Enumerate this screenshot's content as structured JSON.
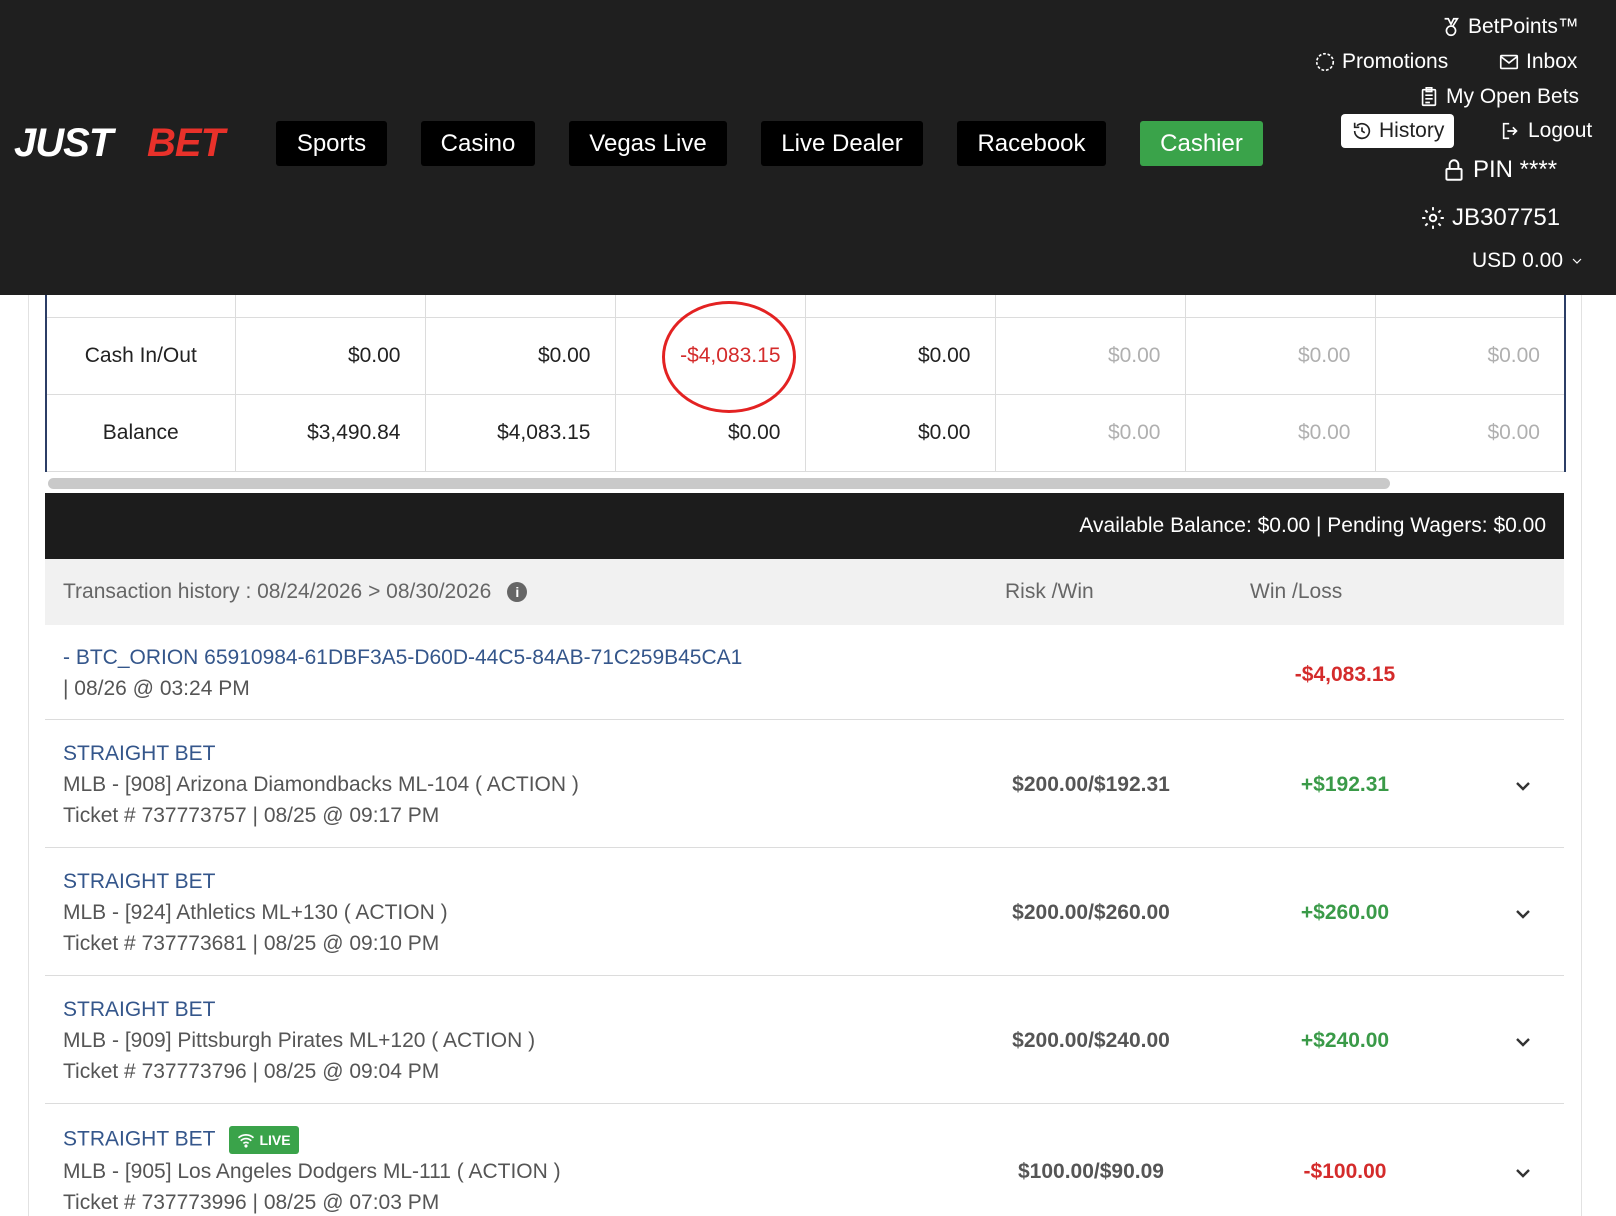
{
  "header": {
    "logo": {
      "part1": "JUST",
      "part2": "BET"
    },
    "nav": [
      {
        "label": "Sports"
      },
      {
        "label": "Casino"
      },
      {
        "label": "Vegas Live"
      },
      {
        "label": "Live Dealer"
      },
      {
        "label": "Racebook"
      },
      {
        "label": "Cashier"
      }
    ],
    "utility": {
      "betpoints": "BetPoints™",
      "promotions": "Promotions",
      "inbox": "Inbox",
      "open_bets": "My Open Bets",
      "history": "History",
      "logout": "Logout",
      "pin": "PIN ****",
      "account_id": "JB307751",
      "currency": "USD 0.00"
    }
  },
  "summary_table": {
    "rows": [
      {
        "label": "Cash In/Out",
        "values": [
          "$0.00",
          "$0.00",
          "-$4,083.15",
          "$0.00",
          "$0.00",
          "$0.00",
          "$0.00"
        ]
      },
      {
        "label": "Balance",
        "values": [
          "$3,490.84",
          "$4,083.15",
          "$0.00",
          "$0.00",
          "$0.00",
          "$0.00",
          "$0.00"
        ]
      }
    ]
  },
  "balance_bar": "Available Balance: $0.00 | Pending Wagers: $0.00",
  "history_header": {
    "title": "Transaction history : 08/24/2026 > 08/30/2026",
    "col_risk_win": "Risk /Win",
    "col_win_loss": "Win /Loss"
  },
  "transactions": [
    {
      "line1": "- BTC_ORION 65910984-61DBF3A5-D60D-44C5-84AB-71C259B45CA1",
      "line2": "| 08/26 @ 03:24 PM",
      "risk_win": "",
      "win_loss": "-$4,083.15"
    },
    {
      "line1": "STRAIGHT BET",
      "line2": "MLB - [908] Arizona Diamondbacks ML-104 ( ACTION )",
      "line3": "Ticket # 737773757 | 08/25 @ 09:17 PM",
      "risk_win": "$200.00/$192.31",
      "win_loss": "+$192.31"
    },
    {
      "line1": "STRAIGHT BET",
      "line2": "MLB - [924] Athletics ML+130 ( ACTION )",
      "line3": "Ticket # 737773681 | 08/25 @ 09:10 PM",
      "risk_win": "$200.00/$260.00",
      "win_loss": "+$260.00"
    },
    {
      "line1": "STRAIGHT BET",
      "line2": "MLB - [909] Pittsburgh Pirates ML+120 ( ACTION )",
      "line3": "Ticket # 737773796 | 08/25 @ 09:04 PM",
      "risk_win": "$200.00/$240.00",
      "win_loss": "+$240.00"
    },
    {
      "line1": "STRAIGHT BET",
      "badge": "LIVE",
      "line2": "MLB - [905] Los Angeles Dodgers ML-111 ( ACTION )",
      "line3": "Ticket # 737773996 | 08/25 @ 07:03 PM",
      "risk_win": "$100.00/$90.09",
      "win_loss": "-$100.00"
    }
  ],
  "colors": {
    "header_bg": "#1f1f1f",
    "cashier_green": "#3aa34a",
    "logo_red": "#e8312a",
    "negative": "#d42b2b",
    "positive": "#3a9a48",
    "link_blue": "#34568b"
  }
}
